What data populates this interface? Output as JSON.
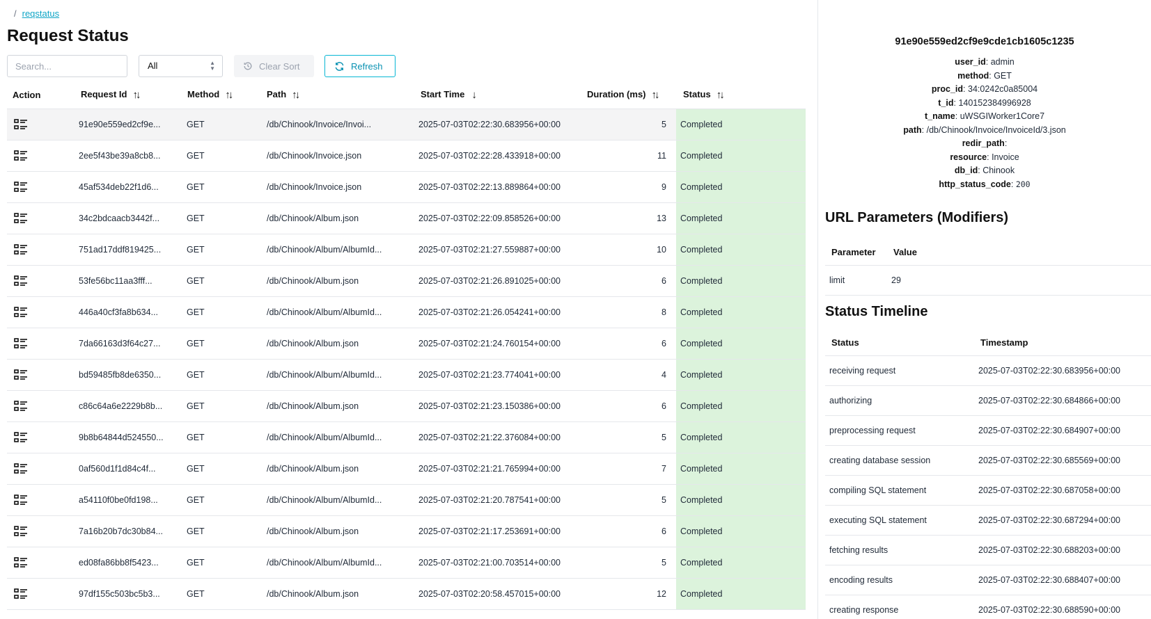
{
  "breadcrumb": {
    "separator": "/",
    "current": "reqstatus"
  },
  "page_title": "Request Status",
  "toolbar": {
    "search_placeholder": "Search...",
    "filter_value": "All",
    "clear_sort_label": "Clear Sort",
    "refresh_label": "Refresh"
  },
  "table": {
    "columns": [
      "Action",
      "Request Id",
      "Method",
      "Path",
      "Start Time",
      "Duration (ms)",
      "Status"
    ],
    "rows": [
      {
        "id": "91e90e559ed2cf9e...",
        "method": "GET",
        "path": "/db/Chinook/Invoice/Invoi...",
        "start": "2025-07-03T02:22:30.683956+00:00",
        "duration": "5",
        "status": "Completed"
      },
      {
        "id": "2ee5f43be39a8cb8...",
        "method": "GET",
        "path": "/db/Chinook/Invoice.json",
        "start": "2025-07-03T02:22:28.433918+00:00",
        "duration": "11",
        "status": "Completed"
      },
      {
        "id": "45af534deb22f1d6...",
        "method": "GET",
        "path": "/db/Chinook/Invoice.json",
        "start": "2025-07-03T02:22:13.889864+00:00",
        "duration": "9",
        "status": "Completed"
      },
      {
        "id": "34c2bdcaacb3442f...",
        "method": "GET",
        "path": "/db/Chinook/Album.json",
        "start": "2025-07-03T02:22:09.858526+00:00",
        "duration": "13",
        "status": "Completed"
      },
      {
        "id": "751ad17ddf819425...",
        "method": "GET",
        "path": "/db/Chinook/Album/AlbumId...",
        "start": "2025-07-03T02:21:27.559887+00:00",
        "duration": "10",
        "status": "Completed"
      },
      {
        "id": "53fe56bc11aa3fff...",
        "method": "GET",
        "path": "/db/Chinook/Album.json",
        "start": "2025-07-03T02:21:26.891025+00:00",
        "duration": "6",
        "status": "Completed"
      },
      {
        "id": "446a40cf3fa8b634...",
        "method": "GET",
        "path": "/db/Chinook/Album/AlbumId...",
        "start": "2025-07-03T02:21:26.054241+00:00",
        "duration": "8",
        "status": "Completed"
      },
      {
        "id": "7da66163d3f64c27...",
        "method": "GET",
        "path": "/db/Chinook/Album.json",
        "start": "2025-07-03T02:21:24.760154+00:00",
        "duration": "6",
        "status": "Completed"
      },
      {
        "id": "bd59485fb8de6350...",
        "method": "GET",
        "path": "/db/Chinook/Album/AlbumId...",
        "start": "2025-07-03T02:21:23.774041+00:00",
        "duration": "4",
        "status": "Completed"
      },
      {
        "id": "c86c64a6e2229b8b...",
        "method": "GET",
        "path": "/db/Chinook/Album.json",
        "start": "2025-07-03T02:21:23.150386+00:00",
        "duration": "6",
        "status": "Completed"
      },
      {
        "id": "9b8b64844d524550...",
        "method": "GET",
        "path": "/db/Chinook/Album/AlbumId...",
        "start": "2025-07-03T02:21:22.376084+00:00",
        "duration": "5",
        "status": "Completed"
      },
      {
        "id": "0af560d1f1d84c4f...",
        "method": "GET",
        "path": "/db/Chinook/Album.json",
        "start": "2025-07-03T02:21:21.765994+00:00",
        "duration": "7",
        "status": "Completed"
      },
      {
        "id": "a54110f0be0fd198...",
        "method": "GET",
        "path": "/db/Chinook/Album/AlbumId...",
        "start": "2025-07-03T02:21:20.787541+00:00",
        "duration": "5",
        "status": "Completed"
      },
      {
        "id": "7a16b20b7dc30b84...",
        "method": "GET",
        "path": "/db/Chinook/Album.json",
        "start": "2025-07-03T02:21:17.253691+00:00",
        "duration": "6",
        "status": "Completed"
      },
      {
        "id": "ed08fa86bb8f5423...",
        "method": "GET",
        "path": "/db/Chinook/Album/AlbumId...",
        "start": "2025-07-03T02:21:00.703514+00:00",
        "duration": "5",
        "status": "Completed"
      },
      {
        "id": "97df155c503bc5b3...",
        "method": "GET",
        "path": "/db/Chinook/Album.json",
        "start": "2025-07-03T02:20:58.457015+00:00",
        "duration": "12",
        "status": "Completed"
      }
    ]
  },
  "detail": {
    "request_id": "91e90e559ed2cf9e9cde1cb1605c1235",
    "fields": [
      {
        "key": "user_id",
        "value": "admin"
      },
      {
        "key": "method",
        "value": "GET"
      },
      {
        "key": "proc_id",
        "value": "34:0242c0a85004"
      },
      {
        "key": "t_id",
        "value": "140152384996928"
      },
      {
        "key": "t_name",
        "value": "uWSGIWorker1Core7"
      },
      {
        "key": "path",
        "value": "/db/Chinook/Invoice/InvoiceId/3.json"
      },
      {
        "key": "redir_path",
        "value": ""
      },
      {
        "key": "resource",
        "value": "Invoice"
      },
      {
        "key": "db_id",
        "value": "Chinook"
      },
      {
        "key": "http_status_code",
        "value": "200"
      }
    ],
    "url_params_title": "URL Parameters (Modifiers)",
    "url_params_columns": [
      "Parameter",
      "Value"
    ],
    "url_params": [
      {
        "parameter": "limit",
        "value": "29"
      }
    ],
    "timeline_title": "Status Timeline",
    "timeline_columns": [
      "Status",
      "Timestamp"
    ],
    "timeline": [
      {
        "status": "receiving request",
        "timestamp": "2025-07-03T02:22:30.683956+00:00"
      },
      {
        "status": "authorizing",
        "timestamp": "2025-07-03T02:22:30.684866+00:00"
      },
      {
        "status": "preprocessing request",
        "timestamp": "2025-07-03T02:22:30.684907+00:00"
      },
      {
        "status": "creating database session",
        "timestamp": "2025-07-03T02:22:30.685569+00:00"
      },
      {
        "status": "compiling SQL statement",
        "timestamp": "2025-07-03T02:22:30.687058+00:00"
      },
      {
        "status": "executing SQL statement",
        "timestamp": "2025-07-03T02:22:30.687294+00:00"
      },
      {
        "status": "fetching results",
        "timestamp": "2025-07-03T02:22:30.688203+00:00"
      },
      {
        "status": "encoding results",
        "timestamp": "2025-07-03T02:22:30.688407+00:00"
      },
      {
        "status": "creating response",
        "timestamp": "2025-07-03T02:22:30.688590+00:00"
      }
    ]
  },
  "colors": {
    "accent": "#06b6d4",
    "status_completed_bg": "#dcf3dc",
    "selected_row_bg": "#f4f4f5",
    "border": "#e5e7eb"
  },
  "icons": {
    "row_action": "details-list-icon",
    "sort": "sort-both-icon",
    "sort_active": "sort-desc-icon",
    "clear_sort": "history-icon",
    "refresh": "refresh-icon",
    "select": "select-arrows-icon"
  }
}
